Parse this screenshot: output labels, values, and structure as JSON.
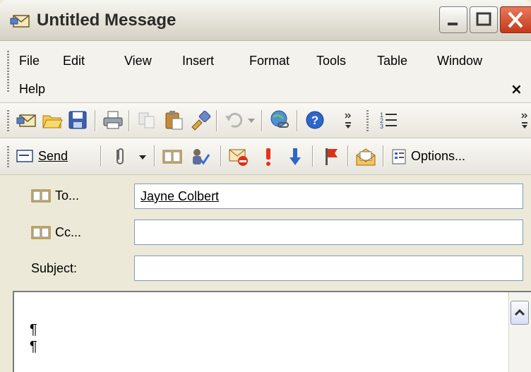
{
  "window": {
    "title": "Untitled Message"
  },
  "menu": {
    "items": [
      "File",
      "Edit",
      "View",
      "Insert",
      "Format",
      "Tools",
      "Table",
      "Window",
      "Help"
    ],
    "close_glyph": "×"
  },
  "toolbar_standard": {
    "icons": [
      "new-message-icon",
      "open-icon",
      "save-icon",
      "print-icon",
      "copy-icon",
      "paste-icon",
      "format-painter-icon",
      "undo-icon",
      "hyperlink-icon",
      "help-icon",
      "bullets-icon"
    ]
  },
  "toolbar_email": {
    "send_label": "Send",
    "options_label": "Options..."
  },
  "headers": {
    "to_label": "To...",
    "to_value": "Jayne Colbert",
    "cc_label": "Cc...",
    "cc_value": "",
    "subject_label": "Subject:",
    "subject_value": ""
  },
  "body": {
    "lines": [
      "¶",
      "¶"
    ]
  },
  "colors": {
    "close_button": "#c33a1a",
    "field_border": "#7f9db9",
    "chrome": "#ece9d8"
  }
}
